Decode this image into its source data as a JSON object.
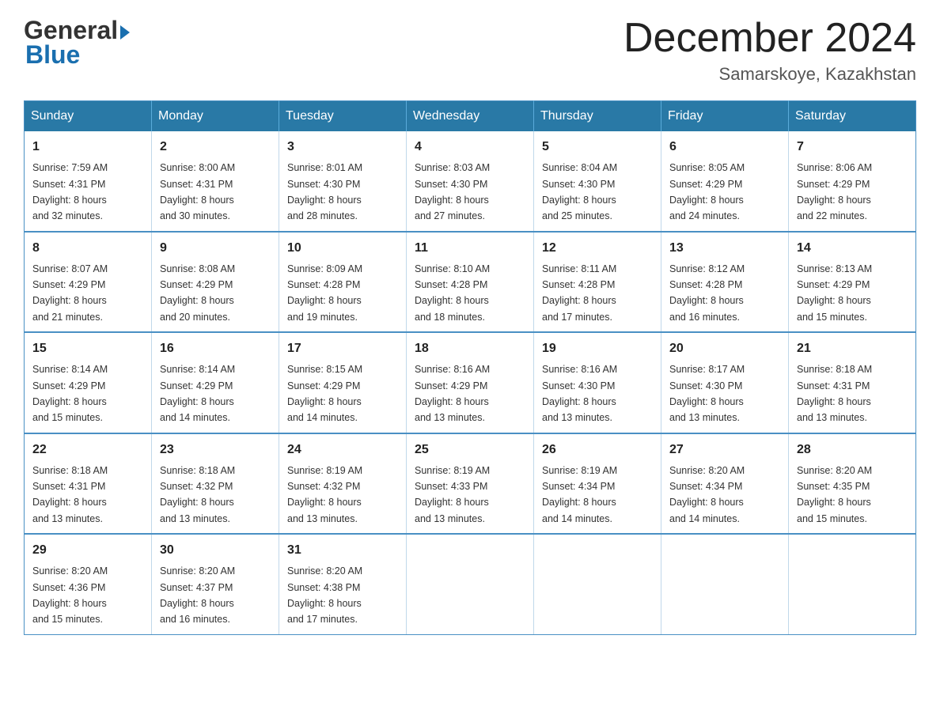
{
  "header": {
    "logo_general": "General",
    "logo_blue": "Blue",
    "month_title": "December 2024",
    "location": "Samarskoye, Kazakhstan"
  },
  "days_of_week": [
    "Sunday",
    "Monday",
    "Tuesday",
    "Wednesday",
    "Thursday",
    "Friday",
    "Saturday"
  ],
  "weeks": [
    [
      {
        "day": "1",
        "sunrise": "7:59 AM",
        "sunset": "4:31 PM",
        "daylight": "8 hours and 32 minutes."
      },
      {
        "day": "2",
        "sunrise": "8:00 AM",
        "sunset": "4:31 PM",
        "daylight": "8 hours and 30 minutes."
      },
      {
        "day": "3",
        "sunrise": "8:01 AM",
        "sunset": "4:30 PM",
        "daylight": "8 hours and 28 minutes."
      },
      {
        "day": "4",
        "sunrise": "8:03 AM",
        "sunset": "4:30 PM",
        "daylight": "8 hours and 27 minutes."
      },
      {
        "day": "5",
        "sunrise": "8:04 AM",
        "sunset": "4:30 PM",
        "daylight": "8 hours and 25 minutes."
      },
      {
        "day": "6",
        "sunrise": "8:05 AM",
        "sunset": "4:29 PM",
        "daylight": "8 hours and 24 minutes."
      },
      {
        "day": "7",
        "sunrise": "8:06 AM",
        "sunset": "4:29 PM",
        "daylight": "8 hours and 22 minutes."
      }
    ],
    [
      {
        "day": "8",
        "sunrise": "8:07 AM",
        "sunset": "4:29 PM",
        "daylight": "8 hours and 21 minutes."
      },
      {
        "day": "9",
        "sunrise": "8:08 AM",
        "sunset": "4:29 PM",
        "daylight": "8 hours and 20 minutes."
      },
      {
        "day": "10",
        "sunrise": "8:09 AM",
        "sunset": "4:28 PM",
        "daylight": "8 hours and 19 minutes."
      },
      {
        "day": "11",
        "sunrise": "8:10 AM",
        "sunset": "4:28 PM",
        "daylight": "8 hours and 18 minutes."
      },
      {
        "day": "12",
        "sunrise": "8:11 AM",
        "sunset": "4:28 PM",
        "daylight": "8 hours and 17 minutes."
      },
      {
        "day": "13",
        "sunrise": "8:12 AM",
        "sunset": "4:28 PM",
        "daylight": "8 hours and 16 minutes."
      },
      {
        "day": "14",
        "sunrise": "8:13 AM",
        "sunset": "4:29 PM",
        "daylight": "8 hours and 15 minutes."
      }
    ],
    [
      {
        "day": "15",
        "sunrise": "8:14 AM",
        "sunset": "4:29 PM",
        "daylight": "8 hours and 15 minutes."
      },
      {
        "day": "16",
        "sunrise": "8:14 AM",
        "sunset": "4:29 PM",
        "daylight": "8 hours and 14 minutes."
      },
      {
        "day": "17",
        "sunrise": "8:15 AM",
        "sunset": "4:29 PM",
        "daylight": "8 hours and 14 minutes."
      },
      {
        "day": "18",
        "sunrise": "8:16 AM",
        "sunset": "4:29 PM",
        "daylight": "8 hours and 13 minutes."
      },
      {
        "day": "19",
        "sunrise": "8:16 AM",
        "sunset": "4:30 PM",
        "daylight": "8 hours and 13 minutes."
      },
      {
        "day": "20",
        "sunrise": "8:17 AM",
        "sunset": "4:30 PM",
        "daylight": "8 hours and 13 minutes."
      },
      {
        "day": "21",
        "sunrise": "8:18 AM",
        "sunset": "4:31 PM",
        "daylight": "8 hours and 13 minutes."
      }
    ],
    [
      {
        "day": "22",
        "sunrise": "8:18 AM",
        "sunset": "4:31 PM",
        "daylight": "8 hours and 13 minutes."
      },
      {
        "day": "23",
        "sunrise": "8:18 AM",
        "sunset": "4:32 PM",
        "daylight": "8 hours and 13 minutes."
      },
      {
        "day": "24",
        "sunrise": "8:19 AM",
        "sunset": "4:32 PM",
        "daylight": "8 hours and 13 minutes."
      },
      {
        "day": "25",
        "sunrise": "8:19 AM",
        "sunset": "4:33 PM",
        "daylight": "8 hours and 13 minutes."
      },
      {
        "day": "26",
        "sunrise": "8:19 AM",
        "sunset": "4:34 PM",
        "daylight": "8 hours and 14 minutes."
      },
      {
        "day": "27",
        "sunrise": "8:20 AM",
        "sunset": "4:34 PM",
        "daylight": "8 hours and 14 minutes."
      },
      {
        "day": "28",
        "sunrise": "8:20 AM",
        "sunset": "4:35 PM",
        "daylight": "8 hours and 15 minutes."
      }
    ],
    [
      {
        "day": "29",
        "sunrise": "8:20 AM",
        "sunset": "4:36 PM",
        "daylight": "8 hours and 15 minutes."
      },
      {
        "day": "30",
        "sunrise": "8:20 AM",
        "sunset": "4:37 PM",
        "daylight": "8 hours and 16 minutes."
      },
      {
        "day": "31",
        "sunrise": "8:20 AM",
        "sunset": "4:38 PM",
        "daylight": "8 hours and 17 minutes."
      },
      null,
      null,
      null,
      null
    ]
  ],
  "labels": {
    "sunrise": "Sunrise:",
    "sunset": "Sunset:",
    "daylight": "Daylight:"
  }
}
